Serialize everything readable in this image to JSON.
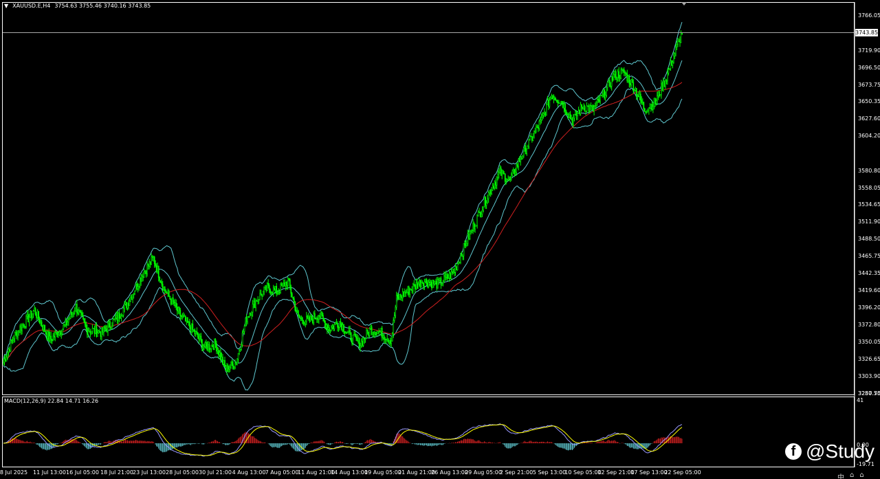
{
  "header": {
    "symbol": "XAUUSD.E,H4",
    "ohlc": "3754.63 3755.46 3740.16 3743.85"
  },
  "price_axis": {
    "ticks": [
      "3766.05",
      "3719.90",
      "3696.50",
      "3673.75",
      "3650.35",
      "3627.60",
      "3604.20",
      "3580.80",
      "3558.05",
      "3534.65",
      "3511.90",
      "3488.50",
      "3465.75",
      "3442.35",
      "3419.60",
      "3396.20",
      "3372.80",
      "3350.05",
      "3326.65",
      "3303.90",
      "3280.50",
      "3257.75"
    ],
    "current_price": "3743.85"
  },
  "macd_header": "MACD(12,26,9) 22.84 14.71 16.26",
  "macd_axis": {
    "top": "41",
    "zero": "0.00",
    "bottom": "-19.71"
  },
  "time_axis": [
    "8 Jul 2025",
    "11 Jul 13:00",
    "16 Jul 05:00",
    "18 Jul 21:00",
    "23 Jul 13:00",
    "28 Jul 05:00",
    "30 Jul 21:00",
    "4 Aug 13:00",
    "7 Aug 05:00",
    "11 Aug 21:00",
    "14 Aug 13:00",
    "19 Aug 05:00",
    "21 Aug 21:00",
    "26 Aug 13:00",
    "29 Aug 05:00",
    "2 Sep 21:00",
    "5 Sep 13:00",
    "10 Sep 05:00",
    "12 Sep 21:00",
    "17 Sep 13:00",
    "22 Sep 05:00"
  ],
  "watermark": {
    "text": "@Study"
  },
  "tray": {
    "ime": "中",
    "icon1": "⌂",
    "icon2": "⌂"
  },
  "colors": {
    "bull": "#00ff00",
    "bear": "#00ff00",
    "bands": "#5fc8d0",
    "ma": "#d02020",
    "macd_pos": "#d02020",
    "macd_neg": "#5fc8d0",
    "macd_line": "#9999ff",
    "signal_line": "#ffff00"
  },
  "chart_data": {
    "type": "line",
    "price_range": [
      3257.75,
      3775
    ],
    "close_anchors": [
      [
        0,
        3300
      ],
      [
        10,
        3335
      ],
      [
        30,
        3370
      ],
      [
        45,
        3330
      ],
      [
        60,
        3350
      ],
      [
        70,
        3375
      ],
      [
        80,
        3345
      ],
      [
        95,
        3340
      ],
      [
        110,
        3360
      ],
      [
        120,
        3380
      ],
      [
        135,
        3420
      ],
      [
        145,
        3440
      ],
      [
        155,
        3400
      ],
      [
        170,
        3365
      ],
      [
        185,
        3340
      ],
      [
        195,
        3320
      ],
      [
        205,
        3325
      ],
      [
        215,
        3290
      ],
      [
        225,
        3300
      ],
      [
        235,
        3360
      ],
      [
        245,
        3385
      ],
      [
        255,
        3400
      ],
      [
        265,
        3395
      ],
      [
        275,
        3410
      ],
      [
        285,
        3360
      ],
      [
        295,
        3355
      ],
      [
        305,
        3365
      ],
      [
        315,
        3345
      ],
      [
        325,
        3355
      ],
      [
        335,
        3335
      ],
      [
        345,
        3325
      ],
      [
        355,
        3345
      ],
      [
        365,
        3340
      ],
      [
        375,
        3330
      ],
      [
        380,
        3385
      ],
      [
        395,
        3400
      ],
      [
        405,
        3410
      ],
      [
        420,
        3405
      ],
      [
        435,
        3420
      ],
      [
        450,
        3470
      ],
      [
        460,
        3500
      ],
      [
        470,
        3530
      ],
      [
        480,
        3555
      ],
      [
        490,
        3545
      ],
      [
        500,
        3575
      ],
      [
        510,
        3600
      ],
      [
        520,
        3625
      ],
      [
        530,
        3660
      ],
      [
        540,
        3650
      ],
      [
        550,
        3625
      ],
      [
        560,
        3645
      ],
      [
        570,
        3640
      ],
      [
        580,
        3660
      ],
      [
        590,
        3685
      ],
      [
        600,
        3690
      ],
      [
        610,
        3670
      ],
      [
        620,
        3640
      ],
      [
        630,
        3650
      ],
      [
        640,
        3680
      ],
      [
        650,
        3720
      ],
      [
        656,
        3744
      ]
    ],
    "bar_count": 657
  }
}
